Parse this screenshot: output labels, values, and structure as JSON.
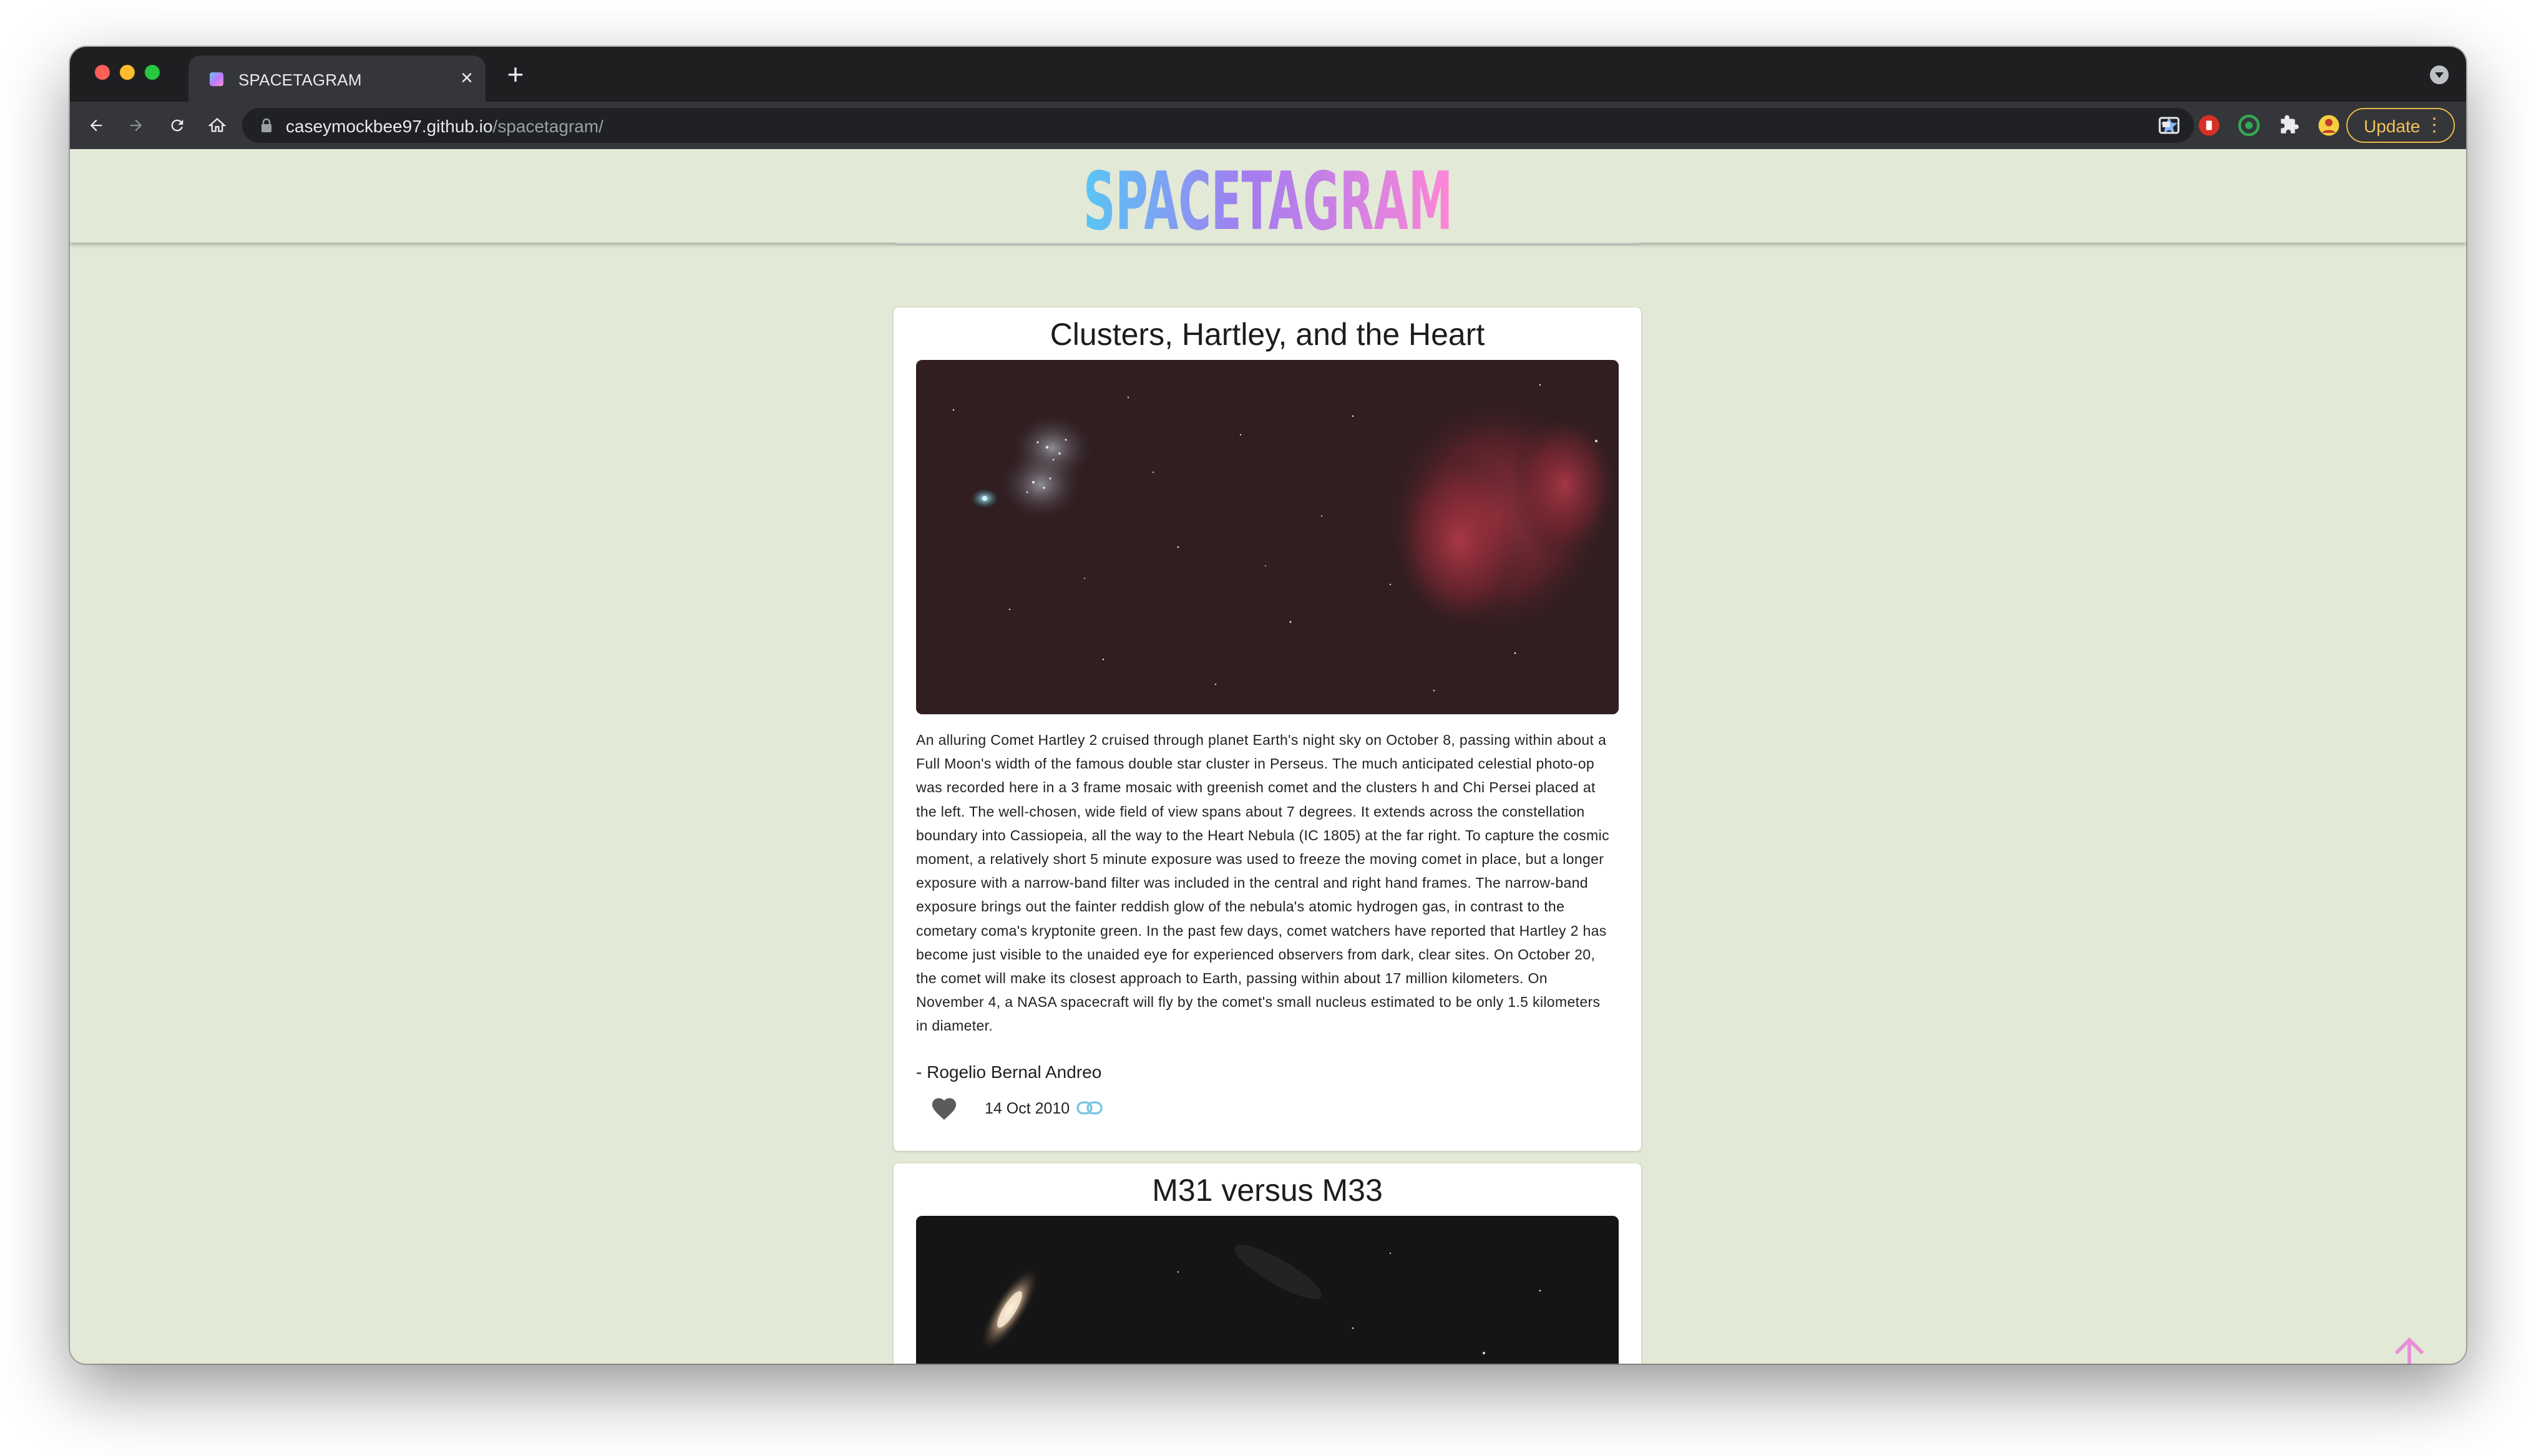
{
  "browser": {
    "tab_title": "SPACETAGRAM",
    "tab_close": "×",
    "new_tab": "+",
    "url_host": "caseymockbee97.github.io",
    "url_path": "/spacetagram/",
    "update_label": "Update",
    "update_menu": "⋮"
  },
  "site": {
    "logo_text": "SPACETAGRAM"
  },
  "posts": [
    {
      "title": "Clusters, Hartley, and the Heart",
      "explanation": "An alluring Comet Hartley 2 cruised through planet Earth's night sky on October 8, passing within about a Full Moon's width of the famous double star cluster in Perseus. The much anticipated celestial photo-op was recorded here in a 3 frame mosaic with greenish comet and the clusters h and Chi Persei placed at the left. The well-chosen, wide field of view spans about 7 degrees. It extends across the constellation boundary into Cassiopeia, all the way to the Heart Nebula (IC 1805) at the far right. To capture the cosmic moment, a relatively short 5 minute exposure was used to freeze the moving comet in place, but a longer exposure with a narrow-band filter was included in the central and right hand frames. The narrow-band exposure brings out the fainter reddish glow of the nebula's atomic hydrogen gas, in contrast to the cometary coma's kryptonite green. In the past few days, comet watchers have reported that Hartley 2 has become just visible to the unaided eye for experienced observers from dark, clear sites. On October 20, the comet will make its closest approach to Earth, passing within about 17 million kilometers. On November 4, a NASA spacecraft will fly by the comet's small nucleus estimated to be only 1.5 kilometers in diameter.",
      "copyright": "- Rogelio Bernal Andreo",
      "date": "14 Oct 2010",
      "liked": false
    },
    {
      "title": "M31 versus M33"
    }
  ],
  "colors": {
    "page_bg": "#e2e9d6",
    "accent_link": "#7ec8e3",
    "scroll_top": "#e78fd8",
    "update_border": "#e8b74a"
  },
  "icons": [
    "back-icon",
    "forward-icon",
    "reload-icon",
    "home-icon",
    "lock-icon",
    "star-icon",
    "heart-icon",
    "link-icon",
    "arrow-up-icon"
  ]
}
